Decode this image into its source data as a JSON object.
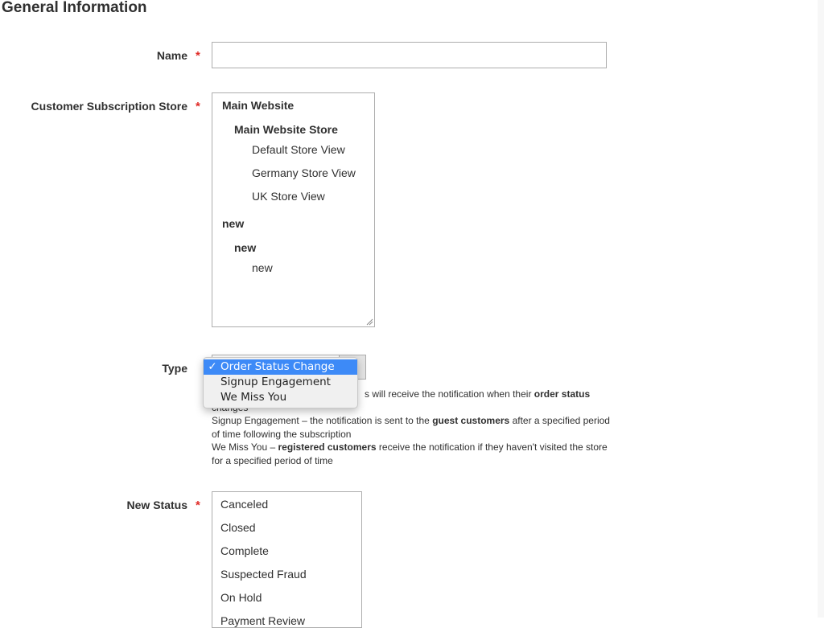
{
  "section": {
    "title": "General Information"
  },
  "form": {
    "name": {
      "label": "Name",
      "required": "*",
      "value": "",
      "placeholder": ""
    },
    "store": {
      "label": "Customer Subscription Store",
      "required": "*",
      "items": [
        {
          "text": "Main Website",
          "level": "website"
        },
        {
          "text": "Main Website Store",
          "level": "group"
        },
        {
          "text": "Default Store View",
          "level": "view"
        },
        {
          "text": "Germany Store View",
          "level": "view"
        },
        {
          "text": "UK Store View",
          "level": "view"
        },
        {
          "text": "new",
          "level": "website"
        },
        {
          "text": "new",
          "level": "group"
        },
        {
          "text": "new",
          "level": "view"
        }
      ]
    },
    "type": {
      "label": "Type",
      "selected": "Order Status Change",
      "check": "✓",
      "options": [
        "Order Status Change",
        "Signup Engagement",
        "We Miss You"
      ],
      "note": {
        "line1_tail": "s will receive the notification when their",
        "line1_bold": "order status",
        "line2": "changes",
        "p2_start": "Signup Engagement – the notification is sent to the",
        "p2_bold": "guest customers",
        "p2_end": "after a specified period of time following the subscription",
        "p3_start": "We Miss You –",
        "p3_bold": "registered customers",
        "p3_end": "receive the notification if they haven't visited the store for a specified period of time"
      }
    },
    "new_status": {
      "label": "New Status",
      "required": "*",
      "items": [
        "Canceled",
        "Closed",
        "Complete",
        "Suspected Fraud",
        "On Hold",
        "Payment Review"
      ]
    }
  },
  "colors": {
    "required": "#e02b27",
    "dropdown_highlight": "#3d8af7",
    "border": "#adadad",
    "text": "#303030"
  }
}
